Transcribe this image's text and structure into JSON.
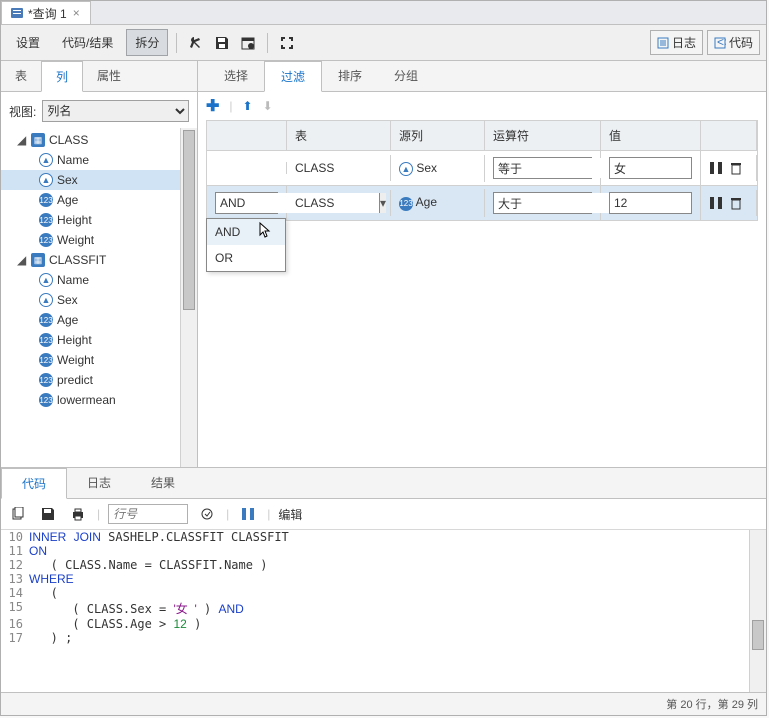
{
  "file_tab": {
    "title": "*查询 1"
  },
  "toolbar": {
    "settings": "设置",
    "code_result": "代码/结果",
    "split": "拆分",
    "log_btn": "日志",
    "code_btn": "代码"
  },
  "left": {
    "tabs": {
      "table": "表",
      "column": "列",
      "attr": "属性"
    },
    "view_label": "视图:",
    "view_options": [
      "列名"
    ],
    "tree": {
      "table1": "CLASS",
      "t1_cols": [
        "Name",
        "Sex",
        "Age",
        "Height",
        "Weight"
      ],
      "table2": "CLASSFIT",
      "t2_cols": [
        "Name",
        "Sex",
        "Age",
        "Height",
        "Weight",
        "predict",
        "lowermean"
      ]
    }
  },
  "right": {
    "tabs": {
      "select": "选择",
      "filter": "过滤",
      "sort": "排序",
      "group": "分组"
    },
    "headers": {
      "logic": "",
      "table": "表",
      "col": "源列",
      "op": "运算符",
      "val": "值"
    },
    "rows": [
      {
        "logic": "",
        "table": "CLASS",
        "col": "Sex",
        "col_type": "char",
        "op": "等于",
        "val": "女"
      },
      {
        "logic": "AND",
        "table": "CLASS",
        "col": "Age",
        "col_type": "num",
        "op": "大于",
        "val": "12"
      }
    ],
    "dropdown": {
      "items": [
        "AND",
        "OR"
      ]
    }
  },
  "bottom": {
    "tabs": {
      "code": "代码",
      "log": "日志",
      "result": "结果"
    },
    "line_placeholder": "行号",
    "edit": "编辑",
    "lines": [
      {
        "n": 10,
        "html": "<span class='kw'>INNER</span> <span class='kw'>JOIN</span> SASHELP.CLASSFIT CLASSFIT"
      },
      {
        "n": 11,
        "html": "<span class='kw'>ON</span>"
      },
      {
        "n": 12,
        "html": "   ( CLASS.Name = CLASSFIT.Name )"
      },
      {
        "n": 13,
        "html": "<span class='kw'>WHERE</span>"
      },
      {
        "n": 14,
        "html": "   ("
      },
      {
        "n": 15,
        "html": "      ( CLASS.Sex = <span class='str'>'女  '</span> ) <span class='kw'>AND</span>"
      },
      {
        "n": 16,
        "html": "      ( CLASS.Age &gt; <span class='num-lit'>12</span> )"
      },
      {
        "n": 17,
        "html": "   ) ;"
      }
    ]
  },
  "status": "第 20 行，第 29 列"
}
